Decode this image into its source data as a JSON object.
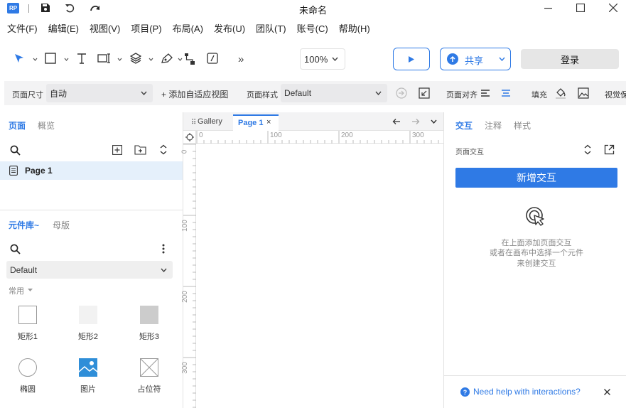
{
  "app": {
    "logo_text": "RP",
    "title": "未命名"
  },
  "menu": [
    {
      "label": "文件(F)"
    },
    {
      "label": "编辑(E)"
    },
    {
      "label": "视图(V)"
    },
    {
      "label": "项目(P)"
    },
    {
      "label": "布局(A)"
    },
    {
      "label": "发布(U)"
    },
    {
      "label": "团队(T)"
    },
    {
      "label": "账号(C)"
    },
    {
      "label": "帮助(H)"
    }
  ],
  "toolbar": {
    "zoom": "100%",
    "share_label": "共享",
    "login_label": "登录",
    "more_glyph": "»"
  },
  "propbar": {
    "page_size_label": "页面尺寸",
    "page_size_value": "自动",
    "add_adaptive_label": "+ 添加自适应视图",
    "page_style_label": "页面样式",
    "page_style_value": "Default",
    "page_align_label": "页面对齐",
    "fill_label": "填充",
    "view_label": "视觉保"
  },
  "left_panel": {
    "tabs": [
      "页面",
      "概览"
    ],
    "pages": [
      {
        "name": "Page 1"
      }
    ],
    "library_tabs": [
      "元件库~",
      "母版"
    ],
    "library_select": "Default",
    "category_label": "常用",
    "widgets": [
      {
        "label": "矩形1"
      },
      {
        "label": "矩形2"
      },
      {
        "label": "矩形3"
      },
      {
        "label": "椭圆"
      },
      {
        "label": "图片"
      },
      {
        "label": "占位符"
      }
    ]
  },
  "canvas": {
    "tabs": [
      {
        "label": "Gallery"
      },
      {
        "label": "Page 1"
      }
    ],
    "ruler_h": [
      "0",
      "100",
      "200",
      "300"
    ],
    "ruler_v": [
      "0",
      "100",
      "200",
      "300"
    ]
  },
  "right_panel": {
    "tabs": [
      "交互",
      "注释",
      "样式"
    ],
    "section_label": "页面交互",
    "add_button": "新增交互",
    "hint_lines": [
      "在上面添加页面交互",
      "或者在画布中选择一个元件",
      "来创建交互"
    ],
    "help_text": "Need help with interactions?"
  },
  "colors": {
    "accent": "#2f7ae5",
    "selected_row": "#e5f0fb"
  }
}
